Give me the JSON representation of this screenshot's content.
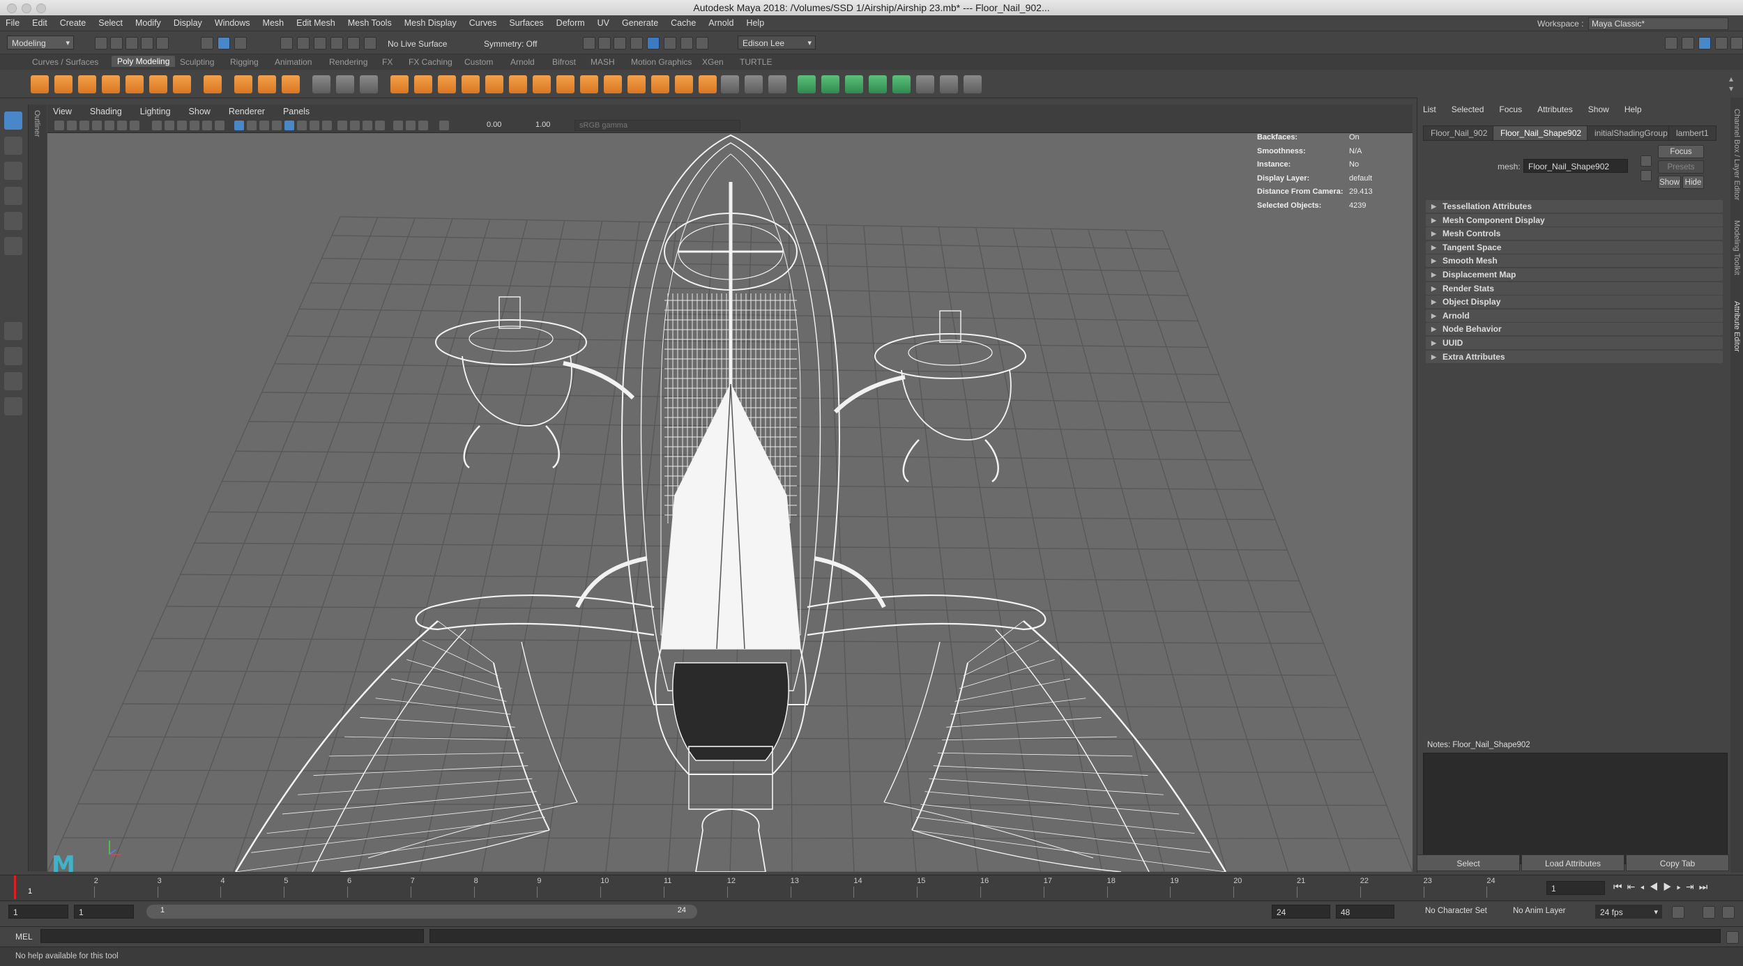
{
  "window": {
    "title": "Autodesk Maya 2018: /Volumes/SSD 1/Airship/Airship 23.mb*   ---   Floor_Nail_902..."
  },
  "menubar": [
    "File",
    "Edit",
    "Create",
    "Select",
    "Modify",
    "Display",
    "Windows",
    "Mesh",
    "Edit Mesh",
    "Mesh Tools",
    "Mesh Display",
    "Curves",
    "Surfaces",
    "Deform",
    "UV",
    "Generate",
    "Cache",
    "Arnold",
    "Help"
  ],
  "workspace": {
    "label": "Workspace :",
    "value": "Maya Classic*"
  },
  "statusline": {
    "mode": "Modeling",
    "live_surface": "No Live Surface",
    "symmetry": "Symmetry: Off",
    "user": "Edison Lee"
  },
  "shelf_tabs": [
    "Curves / Surfaces",
    "Poly Modeling",
    "Sculpting",
    "Rigging",
    "Animation",
    "Rendering",
    "FX",
    "FX Caching",
    "Custom",
    "Arnold",
    "Bifrost",
    "MASH",
    "Motion Graphics",
    "XGen",
    "TURTLE"
  ],
  "shelf_active": "Poly Modeling",
  "outliner_label": "Outliner",
  "viewport": {
    "menu": [
      "View",
      "Shading",
      "Lighting",
      "Show",
      "Renderer",
      "Panels"
    ],
    "exposure": "0.00",
    "gamma": "1.00",
    "colorspace": "sRGB gamma",
    "hud": [
      {
        "label": "Backfaces:",
        "value": "On"
      },
      {
        "label": "Smoothness:",
        "value": "N/A"
      },
      {
        "label": "Instance:",
        "value": "No"
      },
      {
        "label": "Display Layer:",
        "value": "default"
      },
      {
        "label": "Distance From Camera:",
        "value": "29.413"
      },
      {
        "label": "Selected Objects:",
        "value": "4239"
      }
    ],
    "logo": "M"
  },
  "attribute_editor": {
    "menu": [
      "List",
      "Selected",
      "Focus",
      "Attributes",
      "Show",
      "Help"
    ],
    "tabs": [
      "Floor_Nail_902",
      "Floor_Nail_Shape902",
      "initialShadingGroup",
      "lambert1"
    ],
    "active_tab": "Floor_Nail_Shape902",
    "mesh_label": "mesh:",
    "mesh_value": "Floor_Nail_Shape902",
    "focus_btn": "Focus",
    "presets_btn": "Presets",
    "show_btn": "Show",
    "hide_btn": "Hide",
    "sections": [
      "Tessellation Attributes",
      "Mesh Component Display",
      "Mesh Controls",
      "Tangent Space",
      "Smooth Mesh",
      "Displacement Map",
      "Render Stats",
      "Object Display",
      "Arnold",
      "Node Behavior",
      "UUID",
      "Extra Attributes"
    ],
    "notes_label": "Notes:  Floor_Nail_Shape902",
    "bottom_buttons": [
      "Select",
      "Load Attributes",
      "Copy Tab"
    ]
  },
  "side_strip": [
    "Channel Box / Layer Editor",
    "Modeling Toolkit",
    "Attribute Editor"
  ],
  "timeline": {
    "ticks": [
      "1",
      "2",
      "3",
      "4",
      "5",
      "6",
      "7",
      "8",
      "9",
      "10",
      "11",
      "12",
      "13",
      "14",
      "15",
      "16",
      "17",
      "18",
      "19",
      "20",
      "21",
      "22",
      "23",
      "24"
    ],
    "current_frame": "1",
    "current_field": "1"
  },
  "range": {
    "start": "1",
    "playback_start": "1",
    "slider_start": "1",
    "slider_end": "24",
    "playback_end": "24",
    "end": "48",
    "character_set": "No Character Set",
    "anim_layer": "No Anim Layer",
    "fps": "24 fps"
  },
  "cmdline": {
    "lang": "MEL"
  },
  "help": {
    "text": "No help available for this tool"
  }
}
